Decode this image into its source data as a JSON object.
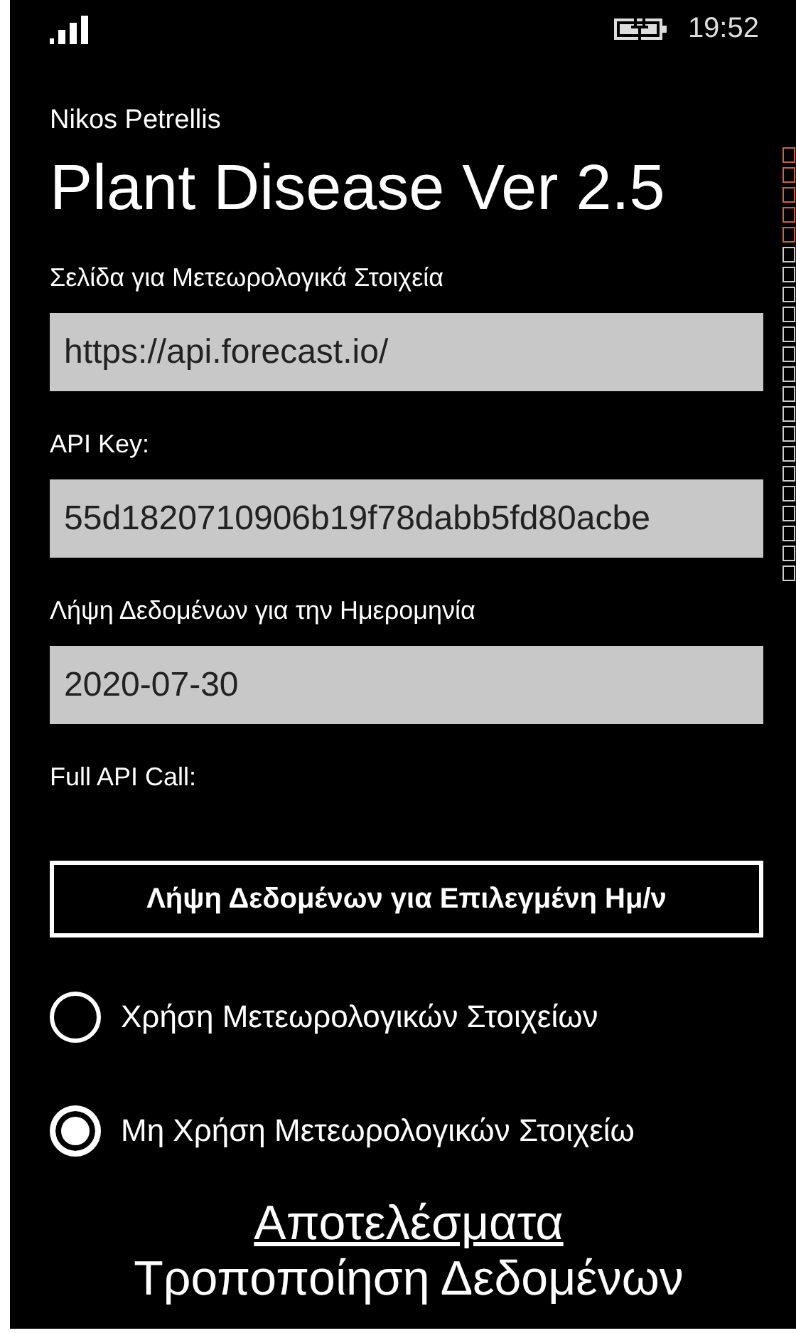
{
  "status_bar": {
    "time": "19:52"
  },
  "author": "Nikos Petrellis",
  "title": "Plant Disease Ver 2.5",
  "fields": [
    {
      "label": "Σελίδα για Μετεωρολογικά Στοιχεία",
      "value": "https://api.forecast.io/"
    },
    {
      "label": "API Key:",
      "value": "55d1820710906b19f78dabb5fd80acbe"
    },
    {
      "label": "Λήψη Δεδομένων για την Ημερομηνία",
      "value": "2020-07-30"
    }
  ],
  "full_api_label": "Full API Call:",
  "button": "Λήψη Δεδομένων για Επιλεγμένη Ημ/ν",
  "radios": [
    {
      "label": "Χρήση Μετεωρολογικών Στοιχείων",
      "selected": false
    },
    {
      "label": "Μη Χρήση Μετεωρολογικών Στοιχείω",
      "selected": true
    }
  ],
  "results_heading": "Αποτελέσματα",
  "next_heading": "Τροποποίηση Δεδομένων"
}
